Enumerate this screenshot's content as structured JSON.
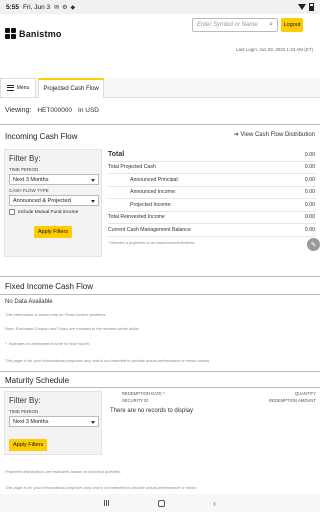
{
  "status_bar": {
    "time": "5:55",
    "date": "Fri, Jun 3"
  },
  "header": {
    "brand": "Banistmo",
    "search_placeholder": "Enter Symbol or Name",
    "logout_label": "Logout",
    "last_login": "Last Login: Jun 03, 2022 1:34 AM (ET)"
  },
  "tabs": {
    "menu_label": "Menu",
    "active_tab": "Projected Cash Flow"
  },
  "viewing": {
    "label": "Viewing:",
    "account": "HET000000",
    "currency": "In USD"
  },
  "incoming": {
    "title": "Incoming Cash Flow",
    "distribution_link": "View Cash Flow Distribution",
    "filter": {
      "title": "Filter By:",
      "time_period_label": "TIME PERIOD",
      "time_period_value": "Next 3 Months",
      "cash_flow_type_label": "CASH FLOW TYPE",
      "cash_flow_type_value": "Announced & Projected",
      "include_mutual_label": "Include Mutual Fund income",
      "apply_label": "Apply Filters"
    },
    "rows": [
      {
        "name": "Total",
        "value": "0.00"
      },
      {
        "name": "Total Projected Cash",
        "value": "0.00"
      },
      {
        "name": "Announced Principal:",
        "value": "0.00"
      },
      {
        "name": "Announced Income:",
        "value": "0.00"
      },
      {
        "name": "Projected Income:",
        "value": "0.00"
      },
      {
        "name": "Total Reinvested Income",
        "value": "0.00"
      },
      {
        "name": "Current Cash Management Balance",
        "value": "0.00"
      }
    ],
    "note": "* Denotes a projection of an unannounced dividend"
  },
  "fixed_income": {
    "title": "Fixed Income Cash Flow",
    "no_data": "No Data Available",
    "note1": "This information is based only on Fixed Income positions.",
    "note2": "Note: Estimated Coupon and Totals are rounded to the nearest whole dollar.",
    "note3": "*- Indicates no estimated income for that month.",
    "note4": "This page is for your informational purposes only and is not intended to provide actual performance or return values."
  },
  "maturity": {
    "title": "Maturity Schedule",
    "filter": {
      "title": "Filter By:",
      "time_period_label": "TIME PERIOD",
      "time_period_value": "Next 3 Months",
      "apply_label": "Apply Filters"
    },
    "col_redemption_date": "REDEMPTION DATE *",
    "col_quantity": "QUANTITY",
    "col_security_id": "SECURITY ID",
    "col_redemption_amount": "REDEMPTION AMOUNT",
    "no_records": "There are no records to display",
    "note1": "Projected distributions are estimates based on historical activities.",
    "note2": "This page is for your informational purposes only and is not intended to provide actual performance or return."
  }
}
